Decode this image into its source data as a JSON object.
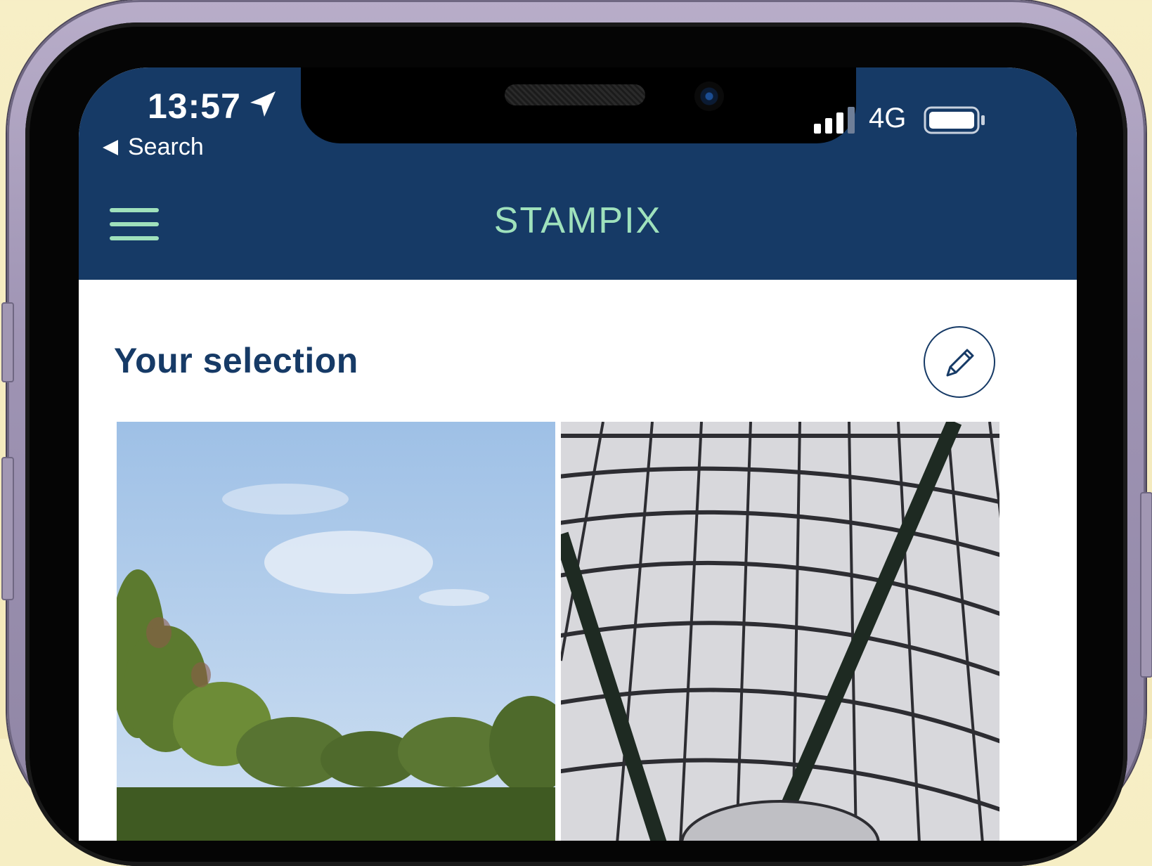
{
  "status_bar": {
    "time": "13:57",
    "back_label": "Search",
    "network": "4G",
    "icons": [
      "location-arrow-icon",
      "signal-bars-icon",
      "battery-icon"
    ]
  },
  "header": {
    "title": "STAMPIX",
    "menu_icon": "hamburger-menu-icon"
  },
  "selection": {
    "title": "Your selection",
    "edit_icon": "pencil-icon",
    "photos": [
      {
        "name": "park-trees-photo"
      },
      {
        "name": "station-roof-photo"
      }
    ]
  },
  "colors": {
    "header_bg": "#163a66",
    "accent": "#9fe1bc",
    "title_text": "#163a66",
    "background": "#f5ecbf"
  }
}
